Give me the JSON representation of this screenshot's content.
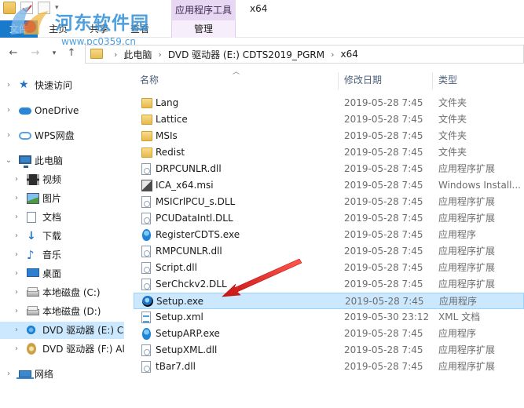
{
  "ribbon": {
    "tabs": [
      "文件",
      "主页",
      "共享",
      "查看"
    ],
    "context_group": "应用程序工具",
    "context_tab": "管理",
    "window_title": "x64"
  },
  "watermark": {
    "title": "河东软件园",
    "url": "www.pc0359.cn"
  },
  "address": {
    "crumbs": [
      "此电脑",
      "DVD 驱动器 (E:) CDTS2019_PGRM",
      "x64"
    ]
  },
  "nav": {
    "items": [
      {
        "label": "快速访问",
        "icon": "star-icon",
        "chev": "›"
      },
      {
        "label": "OneDrive",
        "icon": "cloud-icon",
        "chev": "›"
      },
      {
        "label": "WPS网盘",
        "icon": "wps-cloud-icon",
        "chev": "›"
      },
      {
        "label": "此电脑",
        "icon": "computer-icon",
        "chev": "⌄"
      },
      {
        "label": "视频",
        "icon": "video-folder-icon",
        "chev": "›"
      },
      {
        "label": "图片",
        "icon": "pictures-folder-icon",
        "chev": "›"
      },
      {
        "label": "文档",
        "icon": "documents-folder-icon",
        "chev": "›"
      },
      {
        "label": "下载",
        "icon": "download-folder-icon",
        "chev": "›"
      },
      {
        "label": "音乐",
        "icon": "music-folder-icon",
        "chev": "›"
      },
      {
        "label": "桌面",
        "icon": "desktop-folder-icon",
        "chev": "›"
      },
      {
        "label": "本地磁盘 (C:)",
        "icon": "drive-icon",
        "chev": "›"
      },
      {
        "label": "本地磁盘 (D:)",
        "icon": "drive-icon",
        "chev": "›"
      },
      {
        "label": "DVD 驱动器 (E:) CI",
        "icon": "dvd-drive-icon",
        "chev": "›"
      },
      {
        "label": "DVD 驱动器 (F:) Al",
        "icon": "dvd-drive-icon",
        "chev": "›"
      },
      {
        "label": "网络",
        "icon": "network-icon",
        "chev": "›"
      }
    ]
  },
  "list": {
    "columns": {
      "name": "名称",
      "date": "修改日期",
      "type": "类型"
    },
    "rows": [
      {
        "name": "Lang",
        "date": "2019-05-28 7:45",
        "type": "文件夹",
        "icon": "folder-icon"
      },
      {
        "name": "Lattice",
        "date": "2019-05-28 7:45",
        "type": "文件夹",
        "icon": "folder-icon"
      },
      {
        "name": "MSIs",
        "date": "2019-05-28 7:45",
        "type": "文件夹",
        "icon": "folder-icon"
      },
      {
        "name": "Redist",
        "date": "2019-05-28 7:45",
        "type": "文件夹",
        "icon": "folder-icon"
      },
      {
        "name": "DRPCUNLR.dll",
        "date": "2019-05-28 7:45",
        "type": "应用程序扩展",
        "icon": "dll-file-icon"
      },
      {
        "name": "ICA_x64.msi",
        "date": "2019-05-28 7:45",
        "type": "Windows Install...",
        "icon": "msi-file-icon"
      },
      {
        "name": "MSICrlPCU_s.DLL",
        "date": "2019-05-28 7:45",
        "type": "应用程序扩展",
        "icon": "dll-file-icon"
      },
      {
        "name": "PCUDataIntl.DLL",
        "date": "2019-05-28 7:45",
        "type": "应用程序扩展",
        "icon": "dll-file-icon"
      },
      {
        "name": "RegisterCDTS.exe",
        "date": "2019-05-28 7:45",
        "type": "应用程序",
        "icon": "exe-file-icon"
      },
      {
        "name": "RMPCUNLR.dll",
        "date": "2019-05-28 7:45",
        "type": "应用程序扩展",
        "icon": "dll-file-icon"
      },
      {
        "name": "Script.dll",
        "date": "2019-05-28 7:45",
        "type": "应用程序扩展",
        "icon": "dll-file-icon"
      },
      {
        "name": "SerChckv2.DLL",
        "date": "2019-05-28 7:45",
        "type": "应用程序扩展",
        "icon": "dll-file-icon"
      },
      {
        "name": "Setup.exe",
        "date": "2019-05-28 7:45",
        "type": "应用程序",
        "icon": "setup-exe-icon",
        "selected": true
      },
      {
        "name": "Setup.xml",
        "date": "2019-05-30 23:12",
        "type": "XML 文档",
        "icon": "xml-file-icon"
      },
      {
        "name": "SetupARP.exe",
        "date": "2019-05-28 7:45",
        "type": "应用程序",
        "icon": "exe-file-icon"
      },
      {
        "name": "SetupXML.dll",
        "date": "2019-05-28 7:45",
        "type": "应用程序扩展",
        "icon": "dll-file-icon"
      },
      {
        "name": "tBar7.dll",
        "date": "2019-05-28 7:45",
        "type": "应用程序扩展",
        "icon": "dll-file-icon"
      }
    ]
  },
  "colors": {
    "accent": "#1979ca",
    "selection": "#cce8ff",
    "annotation_arrow": "#e0262a"
  }
}
